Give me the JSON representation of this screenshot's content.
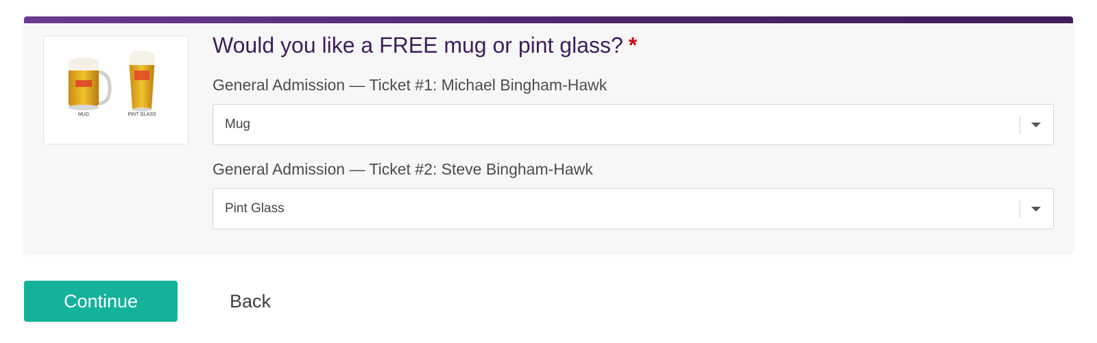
{
  "question": {
    "title": "Would you like a FREE mug or pint glass?",
    "required_marker": "*"
  },
  "image": {
    "mug_caption": "MUG",
    "pint_caption": "PINT GLASS"
  },
  "tickets": [
    {
      "label": "General Admission — Ticket #1: Michael Bingham-Hawk",
      "selected": "Mug"
    },
    {
      "label": "General Admission — Ticket #2: Steve Bingham-Hawk",
      "selected": "Pint Glass"
    }
  ],
  "actions": {
    "continue_label": "Continue",
    "back_label": "Back"
  },
  "colors": {
    "accent_purple": "#4a2468",
    "title_purple": "#3e1d5e",
    "required_red": "#cc0a1a",
    "continue_green": "#14b29b"
  }
}
